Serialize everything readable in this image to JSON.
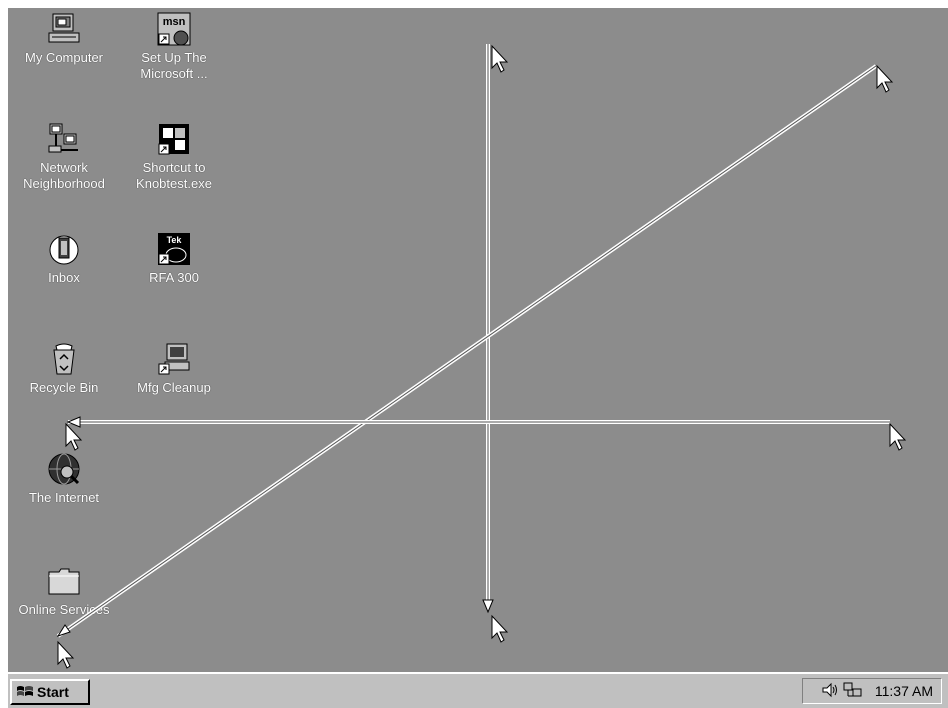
{
  "desktop": {
    "background": "#8c8c8c",
    "icons": [
      {
        "name": "my-computer-icon",
        "label": "My Computer"
      },
      {
        "name": "msn-icon",
        "label": "Set Up The Microsoft ..."
      },
      {
        "name": "network-neighborhood-icon",
        "label": "Network Neighborhood"
      },
      {
        "name": "knobtest-shortcut-icon",
        "label": "Shortcut to Knobtest.exe"
      },
      {
        "name": "inbox-icon",
        "label": "Inbox"
      },
      {
        "name": "tek-rfa300-icon",
        "label": "RFA 300"
      },
      {
        "name": "recycle-bin-icon",
        "label": "Recycle Bin"
      },
      {
        "name": "mfg-cleanup-icon",
        "label": "Mfg Cleanup"
      },
      {
        "name": "the-internet-icon",
        "label": "The Internet"
      },
      {
        "name": "online-services-folder-icon",
        "label": "Online Services"
      }
    ]
  },
  "taskbar": {
    "start_label": "Start",
    "clock": "11:37 AM",
    "tray_icons": [
      "speaker-icon",
      "network-tray-icon"
    ]
  },
  "overlay": {
    "stroke_color": "#ffffff",
    "arrows": [
      "vertical-drag-arrow",
      "diagonal-drag-arrow",
      "horizontal-drag-arrow"
    ]
  }
}
